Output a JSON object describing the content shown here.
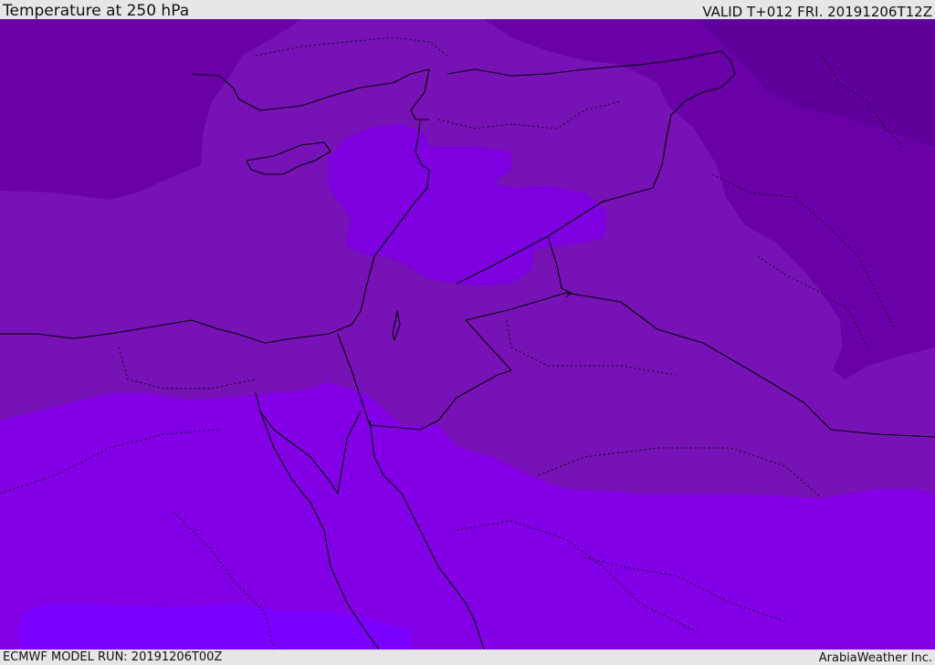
{
  "header": {
    "title": "Temperature at 250 hPa",
    "valid": "VALID T+012 FRI. 20191206T12Z"
  },
  "footer": {
    "model_run": "ECMWF MODEL RUN: 20191206T00Z",
    "credit": "ArabiaWeather Inc."
  },
  "map": {
    "field_colors": {
      "coldest": "#5f009a",
      "colder": "#6a00a8",
      "cold": "#7712b6",
      "mid": "#7e00d9",
      "warm": "#8300e6",
      "warmest": "#7a00ff"
    },
    "line_color": "#000000"
  }
}
